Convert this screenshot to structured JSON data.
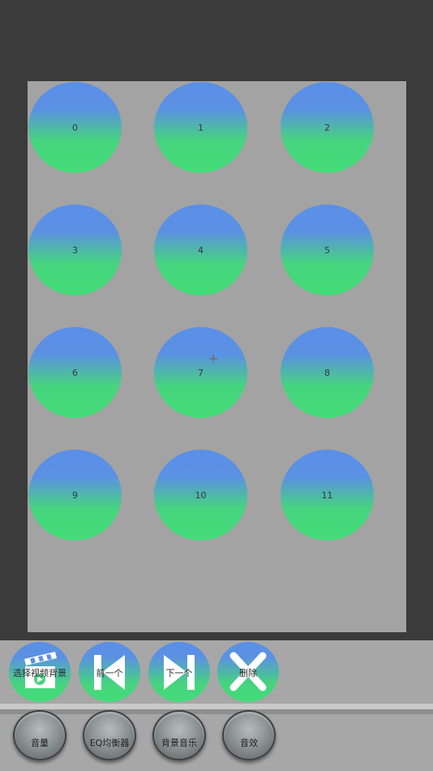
{
  "colors": {
    "background": "#3b3b3b",
    "panel": "#a3a3a3",
    "pad_gradient_top": "#5a8fe8",
    "pad_gradient_bottom": "#43dc78"
  },
  "pads": [
    {
      "label": "0"
    },
    {
      "label": "1"
    },
    {
      "label": "2"
    },
    {
      "label": "3"
    },
    {
      "label": "4"
    },
    {
      "label": "5"
    },
    {
      "label": "6"
    },
    {
      "label": "7"
    },
    {
      "label": "8"
    },
    {
      "label": "9"
    },
    {
      "label": "10"
    },
    {
      "label": "11"
    }
  ],
  "toolbar": {
    "select_bg_video": {
      "label": "选择视频背景",
      "icon": "clapperboard-icon"
    },
    "prev": {
      "label": "前一个",
      "icon": "skip-previous-icon"
    },
    "next": {
      "label": "下一个",
      "icon": "skip-next-icon"
    },
    "delete": {
      "label": "删除",
      "icon": "close-x-icon"
    }
  },
  "bottom_bar": {
    "volume": {
      "label": "音量"
    },
    "eq": {
      "label": "EQ均衡器"
    },
    "bg_music": {
      "label": "背景音乐"
    },
    "sound_effect": {
      "label": "音效"
    }
  }
}
